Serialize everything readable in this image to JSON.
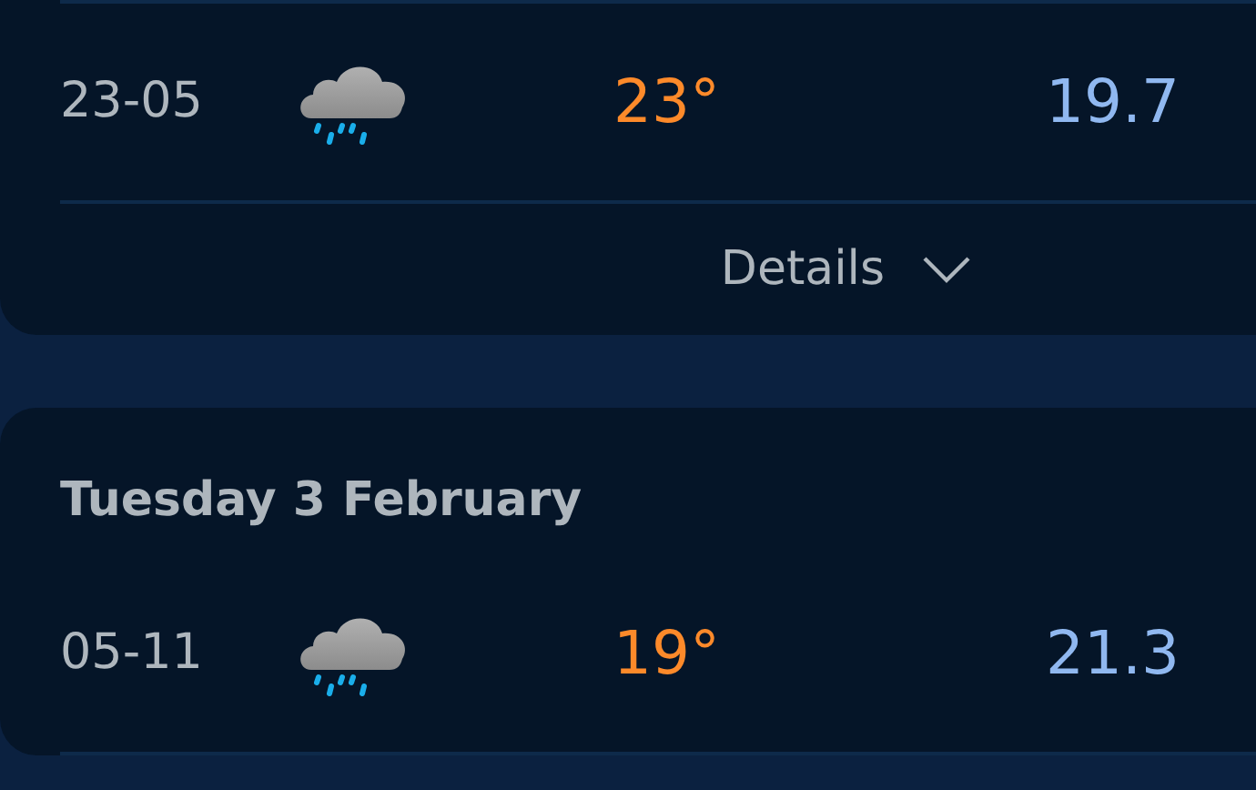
{
  "days": [
    {
      "rows": [
        {
          "time": "23-05",
          "temperature": "23°",
          "value": "19.7"
        }
      ],
      "details": {
        "label": "Details",
        "expanded": false
      }
    },
    {
      "heading": "Tuesday 3 February",
      "rows": [
        {
          "time": "05-11",
          "temperature": "19°",
          "value": "21.3"
        }
      ]
    }
  ]
}
